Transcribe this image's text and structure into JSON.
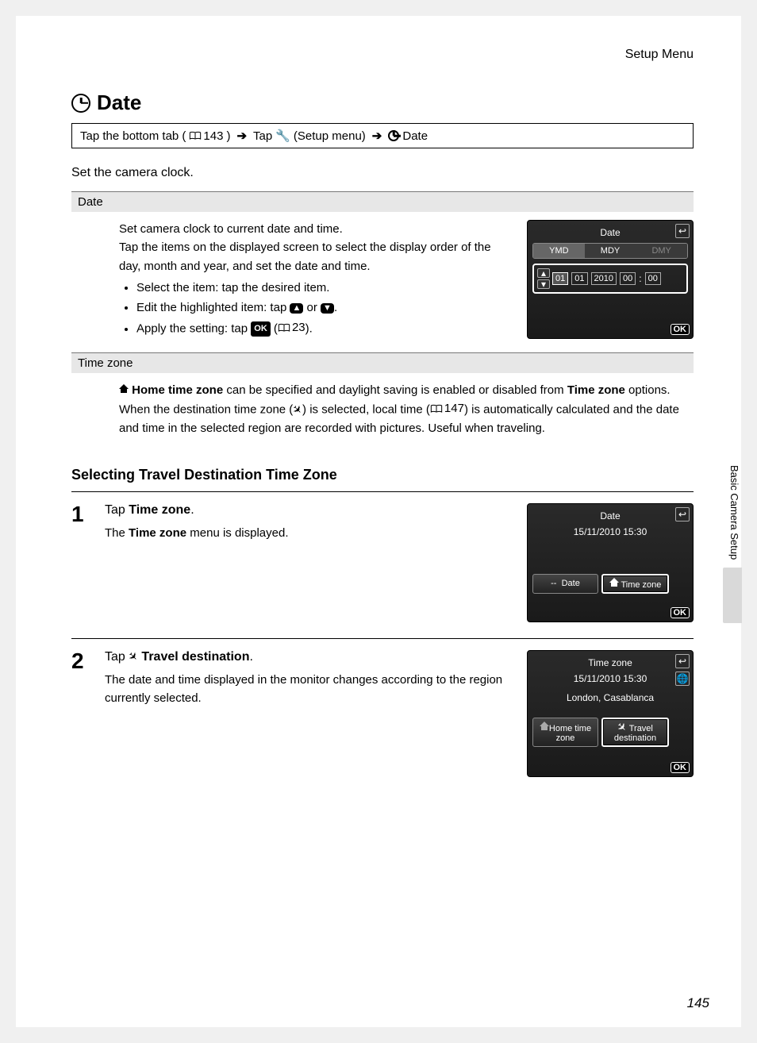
{
  "header": {
    "section": "Setup Menu"
  },
  "title": "Date",
  "breadcrumb": {
    "seg1a": "Tap the bottom tab (",
    "seg1_ref": "143",
    "seg1b": ")",
    "seg2a": "Tap ",
    "seg2b": " (Setup menu)",
    "seg3": " Date"
  },
  "intro": "Set the camera clock.",
  "sub_date": {
    "heading": "Date",
    "p1": "Set camera clock to current date and time.",
    "p2": "Tap the items on the displayed screen to select the display order of the day, month and year, and set the date and time.",
    "b1": "Select the item: tap the desired item.",
    "b2a": "Edit the highlighted item: tap ",
    "b2b": " or ",
    "b2c": ".",
    "b3a": "Apply the setting: tap ",
    "b3_ref": "23",
    "b3b": ")."
  },
  "screen_date": {
    "title": "Date",
    "tabs": [
      "YMD",
      "MDY",
      "DMY"
    ],
    "day": "01",
    "month": "01",
    "year": "2010",
    "hour": "00",
    "minute": "00",
    "ok": "OK"
  },
  "sub_tz": {
    "heading": "Time zone",
    "strong1": "Home time zone",
    "t1": " can be specified and daylight saving is enabled or disabled from ",
    "strong2": "Time zone",
    "t2": " options. When the destination time zone (",
    "t3": ") is selected, local time (",
    "ref": "147",
    "t4": ") is automatically calculated and the date and time in the selected region are recorded with pictures. Useful when traveling."
  },
  "selecting_heading": "Selecting Travel Destination Time Zone",
  "step1": {
    "num": "1",
    "title_a": "Tap ",
    "title_b": "Time zone",
    "title_c": ".",
    "desc_a": "The ",
    "desc_b": "Time zone",
    "desc_c": " menu is displayed."
  },
  "screen_step1": {
    "title": "Date",
    "datetime": "15/11/2010  15:30",
    "btn_left_prefix": "--",
    "btn_left": "Date",
    "btn_right": "Time zone",
    "ok": "OK"
  },
  "step2": {
    "num": "2",
    "title_a": "Tap ",
    "title_b": " Travel destination",
    "title_c": ".",
    "desc": "The date and time displayed in the monitor changes according to the region currently selected."
  },
  "screen_step2": {
    "title": "Time zone",
    "datetime": "15/11/2010  15:30",
    "location": "London, Casablanca",
    "btn_left_l1": "Home time",
    "btn_left_l2": "zone",
    "btn_right_l1": "Travel",
    "btn_right_l2": "destination",
    "ok": "OK"
  },
  "side_tab": "Basic Camera Setup",
  "page_number": "145"
}
